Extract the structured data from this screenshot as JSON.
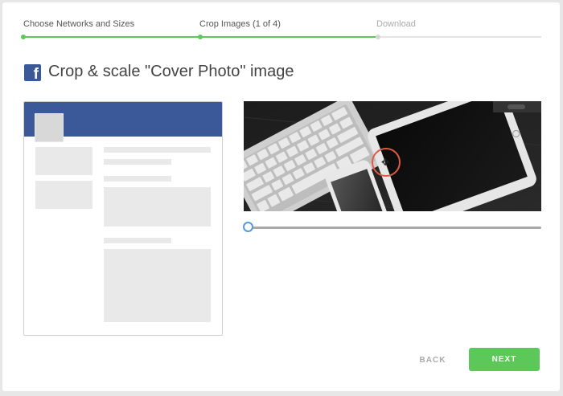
{
  "steps": [
    {
      "label": "Choose Networks and Sizes",
      "state": "done"
    },
    {
      "label": "Crop Images (1 of 4)",
      "state": "current"
    },
    {
      "label": "Download",
      "state": "pending"
    }
  ],
  "title": "Crop & scale \"Cover Photo\" image",
  "network_icon": "facebook-icon",
  "zoom_level": 0,
  "buttons": {
    "back_label": "BACK",
    "next_label": "NEXT"
  },
  "colors": {
    "accent": "#5cc85a",
    "facebook": "#3b5998",
    "handle": "#e05a43",
    "slider": "#5b9bd5"
  }
}
